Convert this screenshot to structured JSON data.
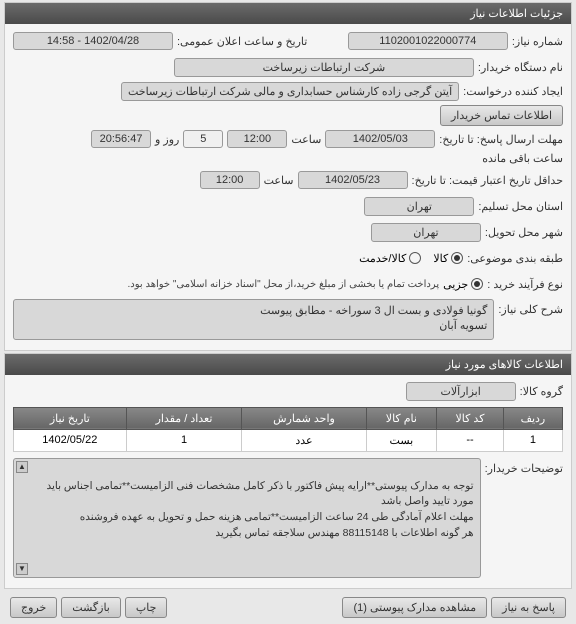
{
  "header1": "جزئیات اطلاعات نیاز",
  "f": {
    "reqno_lbl": "شماره نیاز:",
    "reqno": "1102001022000774",
    "pubdate_lbl": "تاریخ و ساعت اعلان عمومی:",
    "pubdate": "1402/04/28 - 14:58",
    "buyer_lbl": "نام دستگاه خریدار:",
    "buyer": "شرکت ارتباطات زیرساخت",
    "creator_lbl": "ایجاد کننده درخواست:",
    "creator": "آیتن گرجی زاده کارشناس حسابداری و مالی شرکت ارتباطات زیرساخت",
    "contact_btn": "اطلاعات تماس خریدار",
    "deadline_lbl": "مهلت ارسال پاسخ: تا تاریخ:",
    "deadline_date": "1402/05/03",
    "time_lbl": "ساعت",
    "deadline_time": "12:00",
    "days": "5",
    "day_lbl": "روز و",
    "remaining": "20:56:47",
    "remain_lbl": "ساعت باقی مانده",
    "validity_lbl": "حداقل تاریخ اعتبار قیمت: تا تاریخ:",
    "validity_date": "1402/05/23",
    "validity_time": "12:00",
    "reqloc_lbl": "استان محل تسلیم:",
    "reqloc": "تهران",
    "delloc_lbl": "شهر محل تحویل:",
    "delloc": "تهران",
    "cat_lbl": "طبقه بندی موضوعی:",
    "cat_goods": "کالا",
    "cat_service": "کالا/خدمت",
    "proc_lbl": "نوع فرآیند خرید :",
    "proc_partial": "جزیی",
    "proc_note": "پرداخت تمام یا بخشی از مبلغ خرید،از محل \"اسناد خزانه اسلامی\" خواهد بود.",
    "title_lbl": "شرح کلی نیاز:",
    "title": "گونیا فولادی و بست ال 3 سوراخه - مطابق پیوست\nتسویه آبان"
  },
  "header2": "اطلاعات کالاهای مورد نیاز",
  "goods": {
    "group_lbl": "گروه کالا:",
    "group": "ابزارآلات",
    "cols": [
      "ردیف",
      "کد کالا",
      "نام کالا",
      "واحد شمارش",
      "تعداد / مقدار",
      "تاریخ نیاز"
    ],
    "rows": [
      {
        "idx": "1",
        "code": "--",
        "name": "بست",
        "unit": "عدد",
        "qty": "1",
        "date": "1402/05/22"
      }
    ],
    "desc_lbl": "توضیحات خریدار:",
    "desc": "توجه به مدارک پیوستی**ارایه پیش فاکتور با ذکر کامل مشخصات فنی الزامیست**تمامی اجناس باید مورد تایید واصل باشد\nمهلت اعلام آمادگی طی 24 ساعت الزامیست**تمامی هزینه حمل و تحویل به عهده فروشنده\nهر گونه اطلاعات با 88115148 مهندس سلاجقه تماس بگیرید"
  },
  "buttons": {
    "respond": "پاسخ به نیاز",
    "attachments": "مشاهده مدارک پیوستی (1)",
    "print": "چاپ",
    "back": "بازگشت",
    "exit": "خروج"
  }
}
